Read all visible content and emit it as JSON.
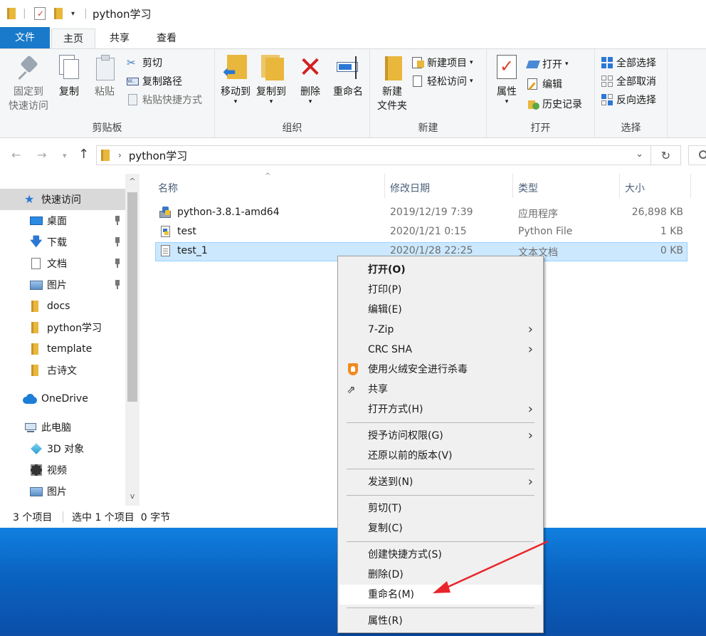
{
  "window": {
    "title": "python学习",
    "menu_tabs": [
      "文件",
      "主页",
      "共享",
      "查看"
    ]
  },
  "ribbon": {
    "clipboard": {
      "label": "剪贴板",
      "pin": "固定到\n快速访问",
      "pin_l1": "固定到",
      "pin_l2": "快速访问",
      "copy": "复制",
      "paste": "粘贴",
      "cut": "剪切",
      "copy_path": "复制路径",
      "paste_shortcut": "粘贴快捷方式"
    },
    "organize": {
      "label": "组织",
      "move_to": "移动到",
      "copy_to": "复制到",
      "delete": "删除",
      "rename": "重命名"
    },
    "new": {
      "label": "新建",
      "new_folder_l1": "新建",
      "new_folder_l2": "文件夹",
      "new_item": "新建项目",
      "easy_access": "轻松访问"
    },
    "open": {
      "label": "打开",
      "properties": "属性",
      "open": "打开",
      "edit": "编辑",
      "history": "历史记录"
    },
    "select": {
      "label": "选择",
      "select_all": "全部选择",
      "select_none": "全部取消",
      "invert": "反向选择"
    }
  },
  "address": {
    "path": "python学习"
  },
  "nav": {
    "items": [
      {
        "label": "快速访问",
        "icon": "star-icon"
      },
      {
        "label": "桌面",
        "icon": "desktop-icon"
      },
      {
        "label": "下载",
        "icon": "download-icon"
      },
      {
        "label": "文档",
        "icon": "document-icon"
      },
      {
        "label": "图片",
        "icon": "pictures-icon"
      },
      {
        "label": "docs",
        "icon": "folder-icon"
      },
      {
        "label": "python学习",
        "icon": "folder-icon"
      },
      {
        "label": "template",
        "icon": "folder-icon"
      },
      {
        "label": "古诗文",
        "icon": "folder-icon"
      },
      {
        "label": "OneDrive",
        "icon": "cloud-icon"
      },
      {
        "label": "此电脑",
        "icon": "computer-icon"
      },
      {
        "label": "3D 对象",
        "icon": "cube-icon"
      },
      {
        "label": "视频",
        "icon": "video-icon"
      },
      {
        "label": "图片",
        "icon": "pictures-icon"
      }
    ]
  },
  "columns": [
    "名称",
    "修改日期",
    "类型",
    "大小"
  ],
  "files": [
    {
      "name": "python-3.8.1-amd64",
      "date": "2019/12/19 7:39",
      "type": "应用程序",
      "size": "26,898 KB"
    },
    {
      "name": "test",
      "date": "2020/1/21 0:15",
      "type": "Python File",
      "size": "1 KB"
    },
    {
      "name": "test_1",
      "date": "2020/1/28 22:25",
      "type": "文本文档",
      "size": "0 KB"
    }
  ],
  "status": {
    "count": "3 个项目",
    "selection": "选中 1 个项目  0 字节"
  },
  "context_menu": {
    "items": [
      "打开(O)",
      "打印(P)",
      "编辑(E)",
      "7-Zip",
      "CRC SHA",
      "使用火绒安全进行杀毒",
      "共享",
      "打开方式(H)",
      "授予访问权限(G)",
      "还原以前的版本(V)",
      "发送到(N)",
      "剪切(T)",
      "复制(C)",
      "创建快捷方式(S)",
      "删除(D)",
      "重命名(M)",
      "属性(R)"
    ]
  },
  "colors": {
    "accent": "#1979ca",
    "selection": "#cce8ff",
    "arrow": "#e8252a"
  }
}
